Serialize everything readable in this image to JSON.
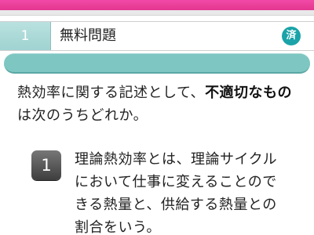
{
  "header": {
    "question_number": "1",
    "category": "無料問題",
    "done_badge": "済"
  },
  "question": {
    "before_emphasis": "熱効率に関する記述として、",
    "emphasis": "不適切なもの",
    "after_emphasis": "は次のうちどれか。"
  },
  "options": [
    {
      "number": "1",
      "text": "理論熱効率とは、理論サイクルにおいて仕事に変えることのできる熱量と、供給する熱量との割合をいう。"
    }
  ],
  "colors": {
    "top_bar": "#e4368f",
    "teal_accent": "#7ec6c2",
    "badge_teal": "#1aa3a8"
  }
}
